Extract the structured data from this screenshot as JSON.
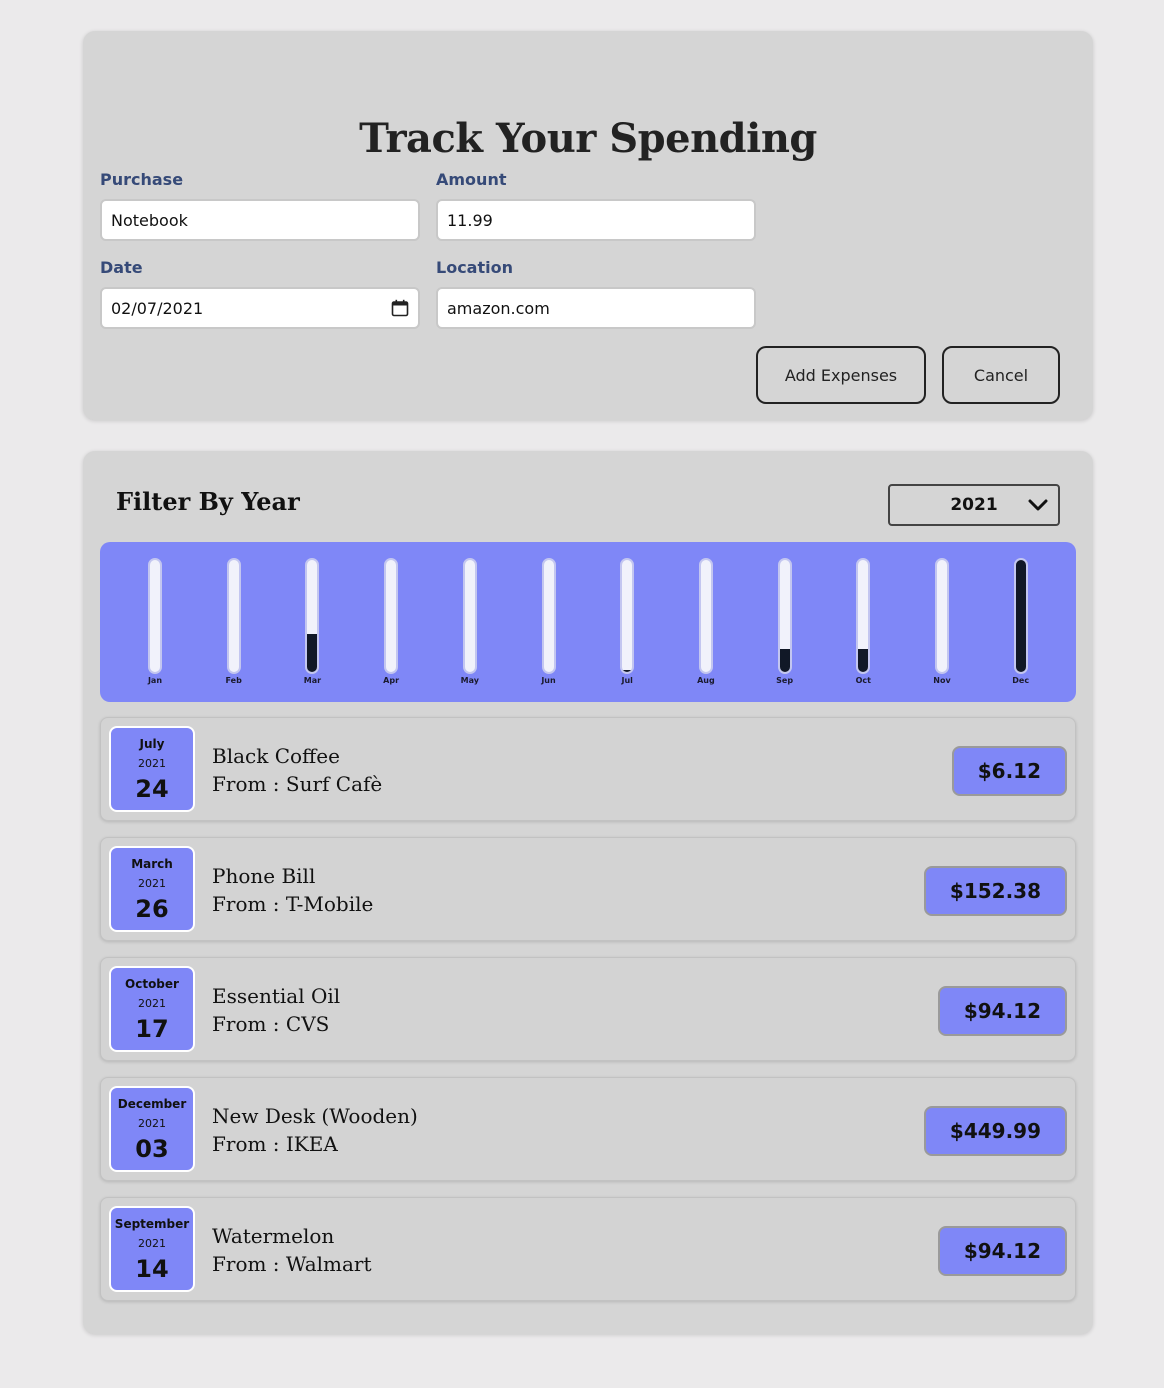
{
  "form": {
    "title": "Track Your Spending",
    "purchase_label": "Purchase",
    "purchase_value": "Notebook",
    "amount_label": "Amount",
    "amount_value": "11.99",
    "date_label": "Date",
    "date_value": "02/07/2021",
    "location_label": "Location",
    "location_value": "amazon.com",
    "add_button": "Add Expenses",
    "cancel_button": "Cancel"
  },
  "filter": {
    "title": "Filter By Year",
    "selected_year": "2021"
  },
  "colors": {
    "accent": "#7f87f7",
    "bar_fill": "#111827",
    "label": "#364a78"
  },
  "chart_data": {
    "type": "bar",
    "categories": [
      "Jan",
      "Feb",
      "Mar",
      "Apr",
      "May",
      "Jun",
      "Jul",
      "Aug",
      "Sep",
      "Oct",
      "Nov",
      "Dec"
    ],
    "values": [
      0,
      0,
      152.38,
      0,
      0,
      0,
      6.12,
      0,
      94.12,
      94.12,
      0,
      449.99
    ],
    "ylim": [
      0,
      449.99
    ]
  },
  "expenses": [
    {
      "month": "July",
      "year": "2021",
      "day": "24",
      "title": "Black Coffee",
      "from": "From : Surf Cafè",
      "price": "$6.12"
    },
    {
      "month": "March",
      "year": "2021",
      "day": "26",
      "title": "Phone Bill",
      "from": "From : T-Mobile",
      "price": "$152.38"
    },
    {
      "month": "October",
      "year": "2021",
      "day": "17",
      "title": "Essential Oil",
      "from": "From : CVS",
      "price": "$94.12"
    },
    {
      "month": "December",
      "year": "2021",
      "day": "03",
      "title": "New Desk (Wooden)",
      "from": "From : IKEA",
      "price": "$449.99"
    },
    {
      "month": "September",
      "year": "2021",
      "day": "14",
      "title": "Watermelon",
      "from": "From : Walmart",
      "price": "$94.12"
    }
  ]
}
